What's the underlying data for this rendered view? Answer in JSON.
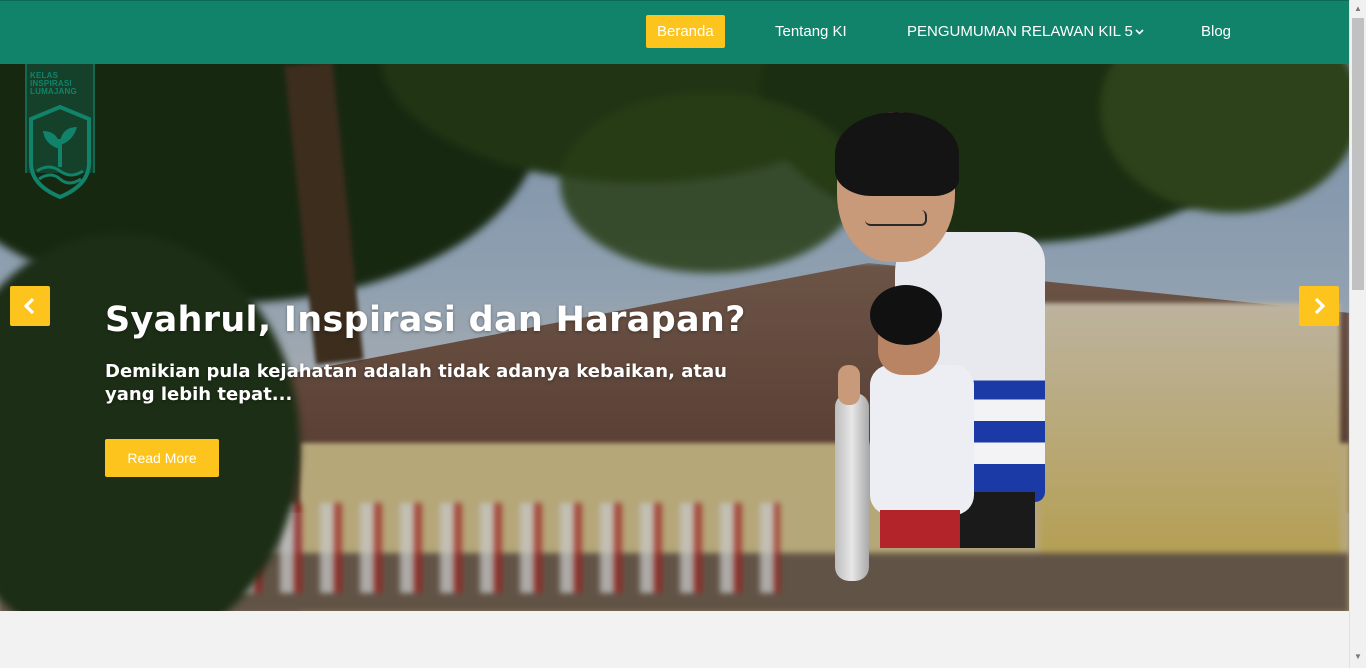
{
  "nav": {
    "items": [
      {
        "label": "Beranda",
        "active": true
      },
      {
        "label": "Tentang KI",
        "active": false
      },
      {
        "label": "PENGUMUMAN RELAWAN KIL 5",
        "active": false,
        "dropdown": true
      },
      {
        "label": "Blog",
        "active": false
      }
    ]
  },
  "logo": {
    "lines": [
      "KELAS",
      "INSPIRASI",
      "LUMAJANG"
    ]
  },
  "slider": {
    "title": "Syahrul, Inspirasi dan Harapan?",
    "excerpt": "Demikian pula kejahatan adalah tidak adanya kebaikan, atau yang lebih tepat...",
    "read_more_label": "Read More",
    "prev_icon": "chevron-left-icon",
    "next_icon": "chevron-right-icon"
  },
  "colors": {
    "primary": "#11836b",
    "accent": "#fcc41c"
  }
}
